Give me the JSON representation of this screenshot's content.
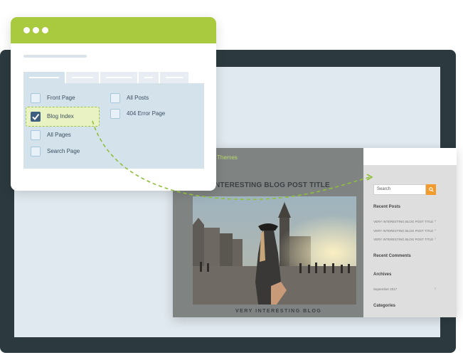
{
  "settings_window": {
    "options": [
      {
        "label": "Front Page",
        "checked": false
      },
      {
        "label": "Blog Index",
        "checked": true
      },
      {
        "label": "All Pages",
        "checked": false
      },
      {
        "label": "Search Page",
        "checked": false
      },
      {
        "label": "All Posts",
        "checked": false
      },
      {
        "label": "404 Error Page",
        "checked": false
      }
    ]
  },
  "blog_preview": {
    "brand": "Themes",
    "post_title": "INTERESTING BLOG POST TITLE",
    "caption": "VERY INTERESTING BLOG",
    "sidebar": {
      "search_placeholder": "Search",
      "recent_posts_heading": "Recent Posts",
      "recent_posts": [
        "VERY INTERESTING BLOG POST TITLE",
        "VERY INTERESTING BLOG POST TITLE",
        "VERY INTERESTING BLOG POST TITLE"
      ],
      "recent_comments_heading": "Recent Comments",
      "archives_heading": "Archives",
      "archive_item": "September 2017",
      "categories_heading": "Categories"
    }
  },
  "colors": {
    "header_green": "#a9c93e",
    "panel_blue": "#d4e2ec",
    "check_blue": "#3d5e7f",
    "monitor_frame": "#2c3a3f",
    "search_orange": "#f29a2c",
    "connector_green": "#8fbf3a"
  },
  "icons": {
    "window_dots": "three-dots-icon",
    "checkmark": "checkmark-icon",
    "search": "search-icon",
    "arrow": "chevron-right-icon"
  }
}
